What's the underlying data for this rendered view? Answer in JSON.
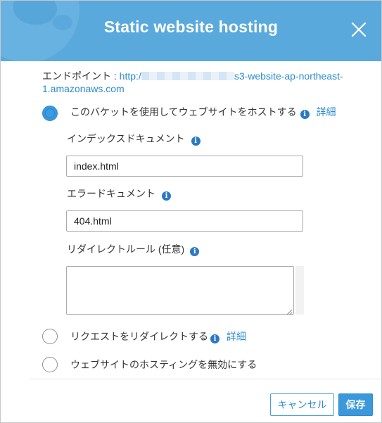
{
  "dialog": {
    "title": "Static website hosting",
    "close_icon": "close-icon"
  },
  "endpoint": {
    "label": "エンドポイント : ",
    "url_start": "http:/",
    "url_end": "s3-website-ap-northeast-1.amazonaws.com"
  },
  "options": {
    "host": {
      "label": "このバケットを使用してウェブサイトをホストする",
      "detail": "詳細",
      "selected": true
    },
    "redirect": {
      "label": "リクエストをリダイレクトする",
      "detail": "詳細",
      "selected": false
    },
    "disable": {
      "label": "ウェブサイトのホスティングを無効にする",
      "selected": false
    }
  },
  "fields": {
    "index": {
      "label": "インデックスドキュメント",
      "value": "index.html"
    },
    "error": {
      "label": "エラードキュメント",
      "value": "404.html"
    },
    "redirect_rules": {
      "label": "リダイレクトルール (任意)",
      "value": ""
    }
  },
  "info_glyph": "i",
  "buttons": {
    "cancel": "キャンセル",
    "save": "保存"
  },
  "colors": {
    "header": "#5aa9dc",
    "accent": "#3a98db",
    "link": "#2c8bcf"
  }
}
